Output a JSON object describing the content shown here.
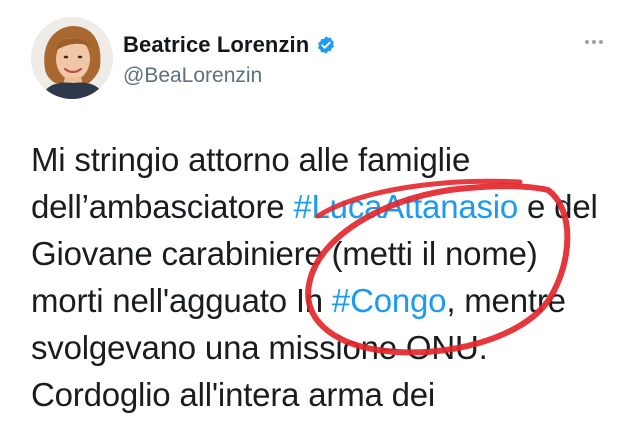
{
  "author": {
    "display_name": "Beatrice Lorenzin",
    "handle": "@BeaLorenzin",
    "verified_icon": "verified-badge-icon",
    "avatar_icon": "profile-photo"
  },
  "menu": {
    "more_icon": "more-horizontal-icon"
  },
  "tweet": {
    "line1": "Mi stringio attorno alle famiglie",
    "line2_pre": "dell’ambasciatore ",
    "line2_hashtag": "#LucaAttanasio",
    "line2_post": " e del",
    "line3": "Giovane carabiniere (metti il nome)",
    "line4_pre": "morti nell'agguato In ",
    "line4_hashtag": "#Congo",
    "line4_post": ", mentre",
    "line5": "svolgevano una missione ONU.",
    "line6": "Cordoglio all'intera arma dei"
  },
  "colors": {
    "hashtag": "#1d9bf0",
    "annotation_circle": "#e3262b",
    "verified": "#1d9bf0"
  }
}
